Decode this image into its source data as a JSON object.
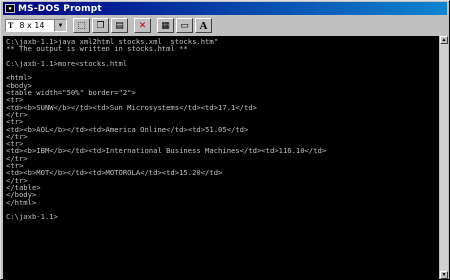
{
  "window": {
    "title": "MS-DOS Prompt"
  },
  "toolbar": {
    "font_size": "8 x 14",
    "buttons": [
      {
        "name": "mark-icon",
        "glyph": "⬚"
      },
      {
        "name": "copy-icon",
        "glyph": "❐"
      },
      {
        "name": "paste-icon",
        "glyph": "📋"
      },
      {
        "name": "full-screen-icon",
        "glyph": "✕"
      },
      {
        "name": "properties-icon",
        "glyph": "🗂"
      },
      {
        "name": "background-icon",
        "glyph": "▭"
      },
      {
        "name": "font-icon",
        "glyph": "A"
      }
    ]
  },
  "console": {
    "lines": [
      "C:\\jaxb-1.1>java xml2html stocks.xml  stocks.htm\"",
      "** The output is written in stocks.html **",
      "",
      "C:\\jaxb-1.1>more<stocks.html",
      "",
      "<html>",
      "<body>",
      "<table width=\"50%\" border=\"2\">",
      "<tr>",
      "<td><b>SUNW</b></td><td>Sun Microsystems</td><td>17.1</td>",
      "</tr>",
      "<tr>",
      "<td><b>AOL</b></td><td>America Online</td><td>51.05</td>",
      "</tr>",
      "<tr>",
      "<td><b>IBM</b></td><td>International Business Machines</td><td>116.10</td>",
      "</tr>",
      "<tr>",
      "<td><b>MOT</b></td><td>MOTOROLA</td><td>15.20</td>",
      "</tr>",
      "</table>",
      "</body>",
      "</html>",
      "",
      "C:\\jaxb-1.1>"
    ]
  },
  "colors": {
    "titlebar_start": "#000080",
    "titlebar_end": "#1084d0",
    "console_bg": "#000000",
    "console_fg": "#c0c0c0"
  }
}
